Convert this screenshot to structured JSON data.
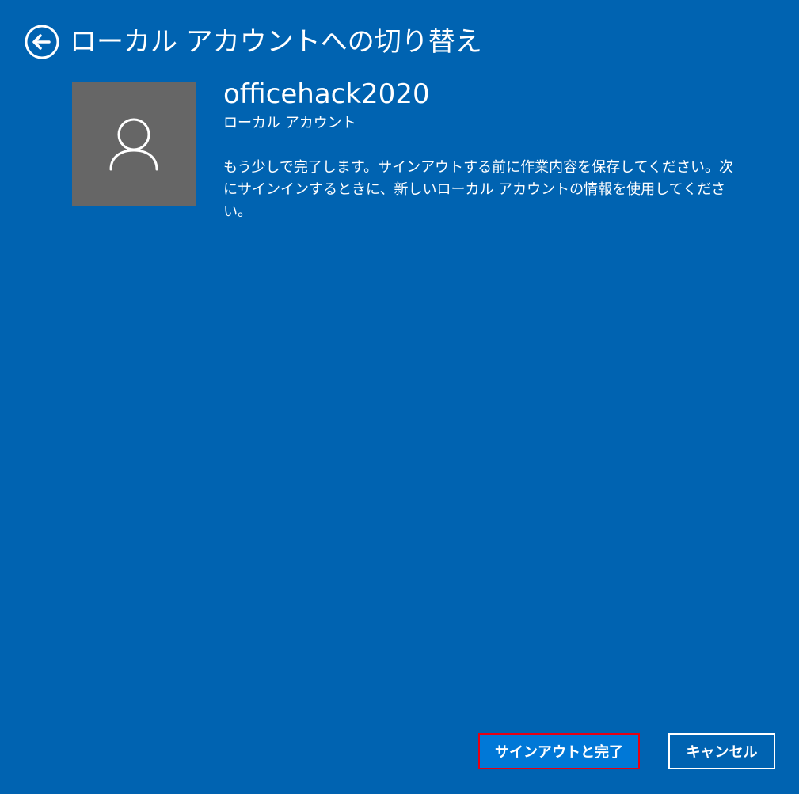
{
  "header": {
    "title": "ローカル アカウントへの切り替え",
    "back_icon": "back-arrow-icon"
  },
  "account": {
    "avatar_icon": "user-icon",
    "username": "officehack2020",
    "type": "ローカル アカウント",
    "message": "もう少しで完了します。サインアウトする前に作業内容を保存してください。次にサインインするときに、新しいローカル アカウントの情報を使用してください。"
  },
  "buttons": {
    "sign_out_label": "サインアウトと完了",
    "cancel_label": "キャンセル"
  },
  "colors": {
    "background": "#0063B1",
    "avatar_bg": "#666666",
    "primary_button": "#0078D7",
    "highlight": "#E60012"
  }
}
